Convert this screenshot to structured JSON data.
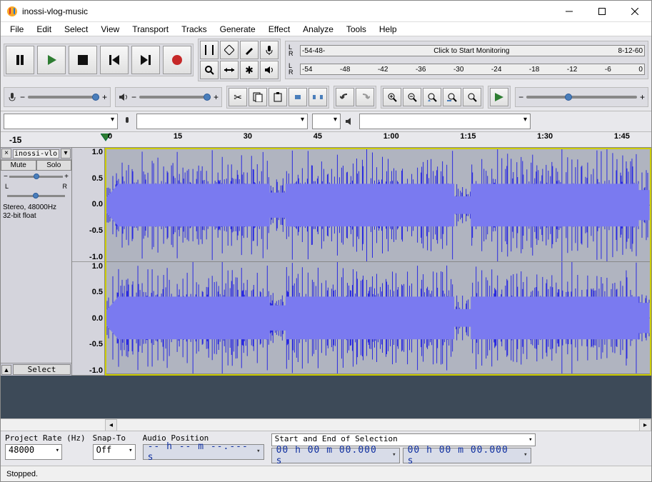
{
  "window": {
    "title": "inossi-vlog-music"
  },
  "menus": [
    "File",
    "Edit",
    "Select",
    "View",
    "Transport",
    "Tracks",
    "Generate",
    "Effect",
    "Analyze",
    "Tools",
    "Help"
  ],
  "meters": {
    "recording": {
      "labels": [
        "-54",
        "-48"
      ],
      "message": "Click to Start Monitoring",
      "tail": [
        "8",
        "-12",
        "-6",
        "0"
      ]
    },
    "playback": {
      "labels": [
        "-54",
        "-48",
        "-42",
        "-36",
        "-30",
        "-24",
        "-18",
        "-12",
        "-6",
        "0"
      ]
    }
  },
  "timeline": {
    "marks": [
      "-15",
      "0",
      "15",
      "30",
      "45",
      "1:00",
      "1:15",
      "1:30",
      "1:45"
    ]
  },
  "track": {
    "name": "inossi-vlo",
    "mute": "Mute",
    "solo": "Solo",
    "pan_labels": {
      "l": "L",
      "r": "R"
    },
    "info_line1": "Stereo, 48000Hz",
    "info_line2": "32-bit float",
    "select": "Select"
  },
  "scale": [
    "1.0",
    "0.5",
    "0.0",
    "-0.5",
    "-1.0"
  ],
  "bottom": {
    "rate_label": "Project Rate (Hz)",
    "rate_value": "48000",
    "snap_label": "Snap-To",
    "snap_value": "Off",
    "pos_label": "Audio Position",
    "pos_value": "-- h -- m --.--- s",
    "sel_label": "Start and End of Selection",
    "sel_start": "00 h 00 m 00.000 s",
    "sel_end": "00 h 00 m 00.000 s"
  },
  "status": "Stopped."
}
